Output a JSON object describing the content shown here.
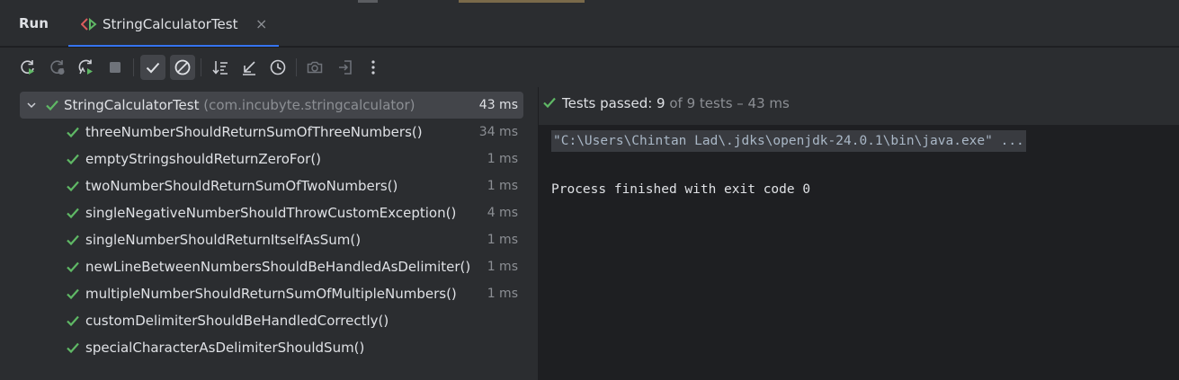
{
  "panel": {
    "title": "Run"
  },
  "tab": {
    "label": "StringCalculatorTest",
    "close_glyph": "×"
  },
  "toolbar": {
    "buttons": [
      {
        "name": "rerun-icon"
      },
      {
        "name": "rerun-failed-icon"
      },
      {
        "name": "toggle-auto-test-icon"
      },
      {
        "name": "stop-icon"
      },
      {
        "name": "show-passed-icon"
      },
      {
        "name": "show-ignored-icon"
      },
      {
        "name": "sort-alphabetically-icon"
      },
      {
        "name": "collapse-all-icon"
      },
      {
        "name": "sort-by-duration-icon"
      },
      {
        "name": "camera-icon"
      },
      {
        "name": "import-tests-icon"
      },
      {
        "name": "more-options-icon"
      }
    ]
  },
  "tree": {
    "root": {
      "label": "StringCalculatorTest",
      "package": "(com.incubyte.stringcalculator)",
      "time": "43 ms"
    },
    "items": [
      {
        "label": "threeNumberShouldReturnSumOfThreeNumbers()",
        "time": "34 ms"
      },
      {
        "label": "emptyStringshouldReturnZeroFor()",
        "time": "1 ms"
      },
      {
        "label": "twoNumberShouldReturnSumOfTwoNumbers()",
        "time": "1 ms"
      },
      {
        "label": "singleNegativeNumberShouldThrowCustomException()",
        "time": "4 ms"
      },
      {
        "label": "singleNumberShouldReturnItselfAsSum()",
        "time": "1 ms"
      },
      {
        "label": "newLineBetweenNumbersShouldBeHandledAsDelimiter()",
        "time": "1 ms"
      },
      {
        "label": "multipleNumberShouldReturnSumOfMultipleNumbers()",
        "time": "1 ms"
      },
      {
        "label": "customDelimiterShouldBeHandledCorrectly()",
        "time": ""
      },
      {
        "label": "specialCharacterAsDelimiterShouldSum()",
        "time": ""
      }
    ]
  },
  "status": {
    "passed_label": "Tests passed: 9",
    "rest": " of 9 tests – 43 ms"
  },
  "console": {
    "command": "\"C:\\Users\\Chintan Lad\\.jdks\\openjdk-24.0.1\\bin\\java.exe\" ...",
    "exit": "Process finished with exit code 0"
  },
  "colors": {
    "pass_green": "#5fb865",
    "accent_blue": "#3574f0",
    "panel_bg": "#2b2d30",
    "console_bg": "#1e1f22"
  }
}
